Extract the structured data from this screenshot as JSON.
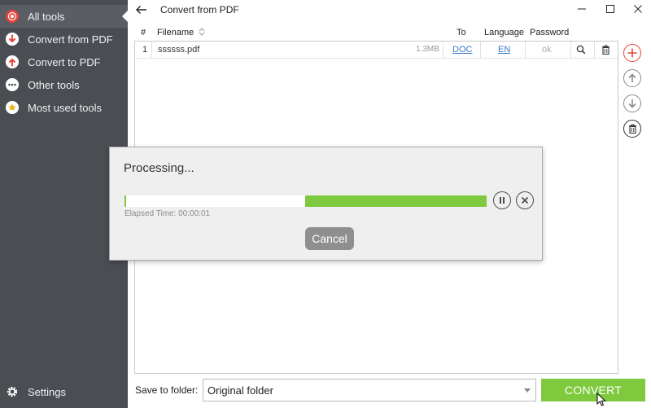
{
  "window": {
    "title": "Convert from PDF"
  },
  "sidebar": {
    "items": [
      {
        "label": "All tools",
        "icon": "all-tools-icon",
        "active": true
      },
      {
        "label": "Convert from PDF",
        "icon": "arrow-down-circle-icon"
      },
      {
        "label": "Convert to PDF",
        "icon": "arrow-up-circle-icon"
      },
      {
        "label": "Other tools",
        "icon": "more-dots-icon"
      },
      {
        "label": "Most used tools",
        "icon": "star-icon"
      }
    ],
    "settings_label": "Settings"
  },
  "table": {
    "headers": {
      "number": "#",
      "filename": "Filename",
      "to": "To",
      "language": "Language",
      "password": "Password"
    },
    "rows": [
      {
        "number": "1",
        "filename": "ssssss.pdf",
        "size": "1.3MB",
        "to": "DOC",
        "language": "EN",
        "password": "ok"
      }
    ]
  },
  "footer": {
    "save_label": "Save to folder:",
    "folder_value": "Original folder",
    "convert_label": "CONVERT"
  },
  "dialog": {
    "title": "Processing...",
    "progress_percent": 50,
    "elapsed_text": "Elapsed Time: 00:00:01",
    "cancel_label": "Cancel"
  },
  "colors": {
    "sidebar_bg": "#4a4d52",
    "accent_green": "#7ec93d",
    "accent_red": "#e8443a",
    "link_blue": "#3b78c9"
  }
}
